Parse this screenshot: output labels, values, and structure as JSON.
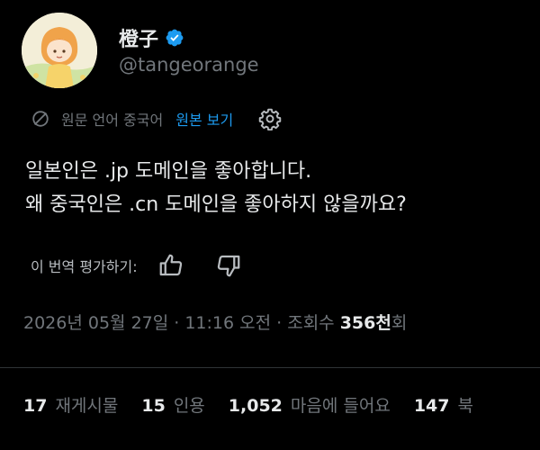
{
  "author": {
    "display_name": "橙子",
    "handle": "@tangeorange",
    "verified": true
  },
  "translation": {
    "note": "원문 언어 중국어",
    "show_original_label": "원본 보기",
    "rate_label": "이 번역 평가하기:"
  },
  "post": {
    "lines": [
      "일본인은 .jp 도메인을 좋아합니다.",
      "왜 중국인은 .cn 도메인을 좋아하지 않을까요?"
    ]
  },
  "meta": {
    "timestamp": "2026년 05월 27일 · 11:16 오전 · 조회수 ",
    "views_count": "356천",
    "views_suffix": "회"
  },
  "stats": {
    "reposts": {
      "count": "17",
      "label": "재게시물"
    },
    "quotes": {
      "count": "15",
      "label": "인용"
    },
    "likes": {
      "count": "1,052",
      "label": "마음에 들어요"
    },
    "bookmarks": {
      "count": "147",
      "label": "북"
    }
  },
  "colors": {
    "background": "#000000",
    "text": "#e7e9ea",
    "secondary": "#71767b",
    "accent": "#1d9bf0"
  }
}
